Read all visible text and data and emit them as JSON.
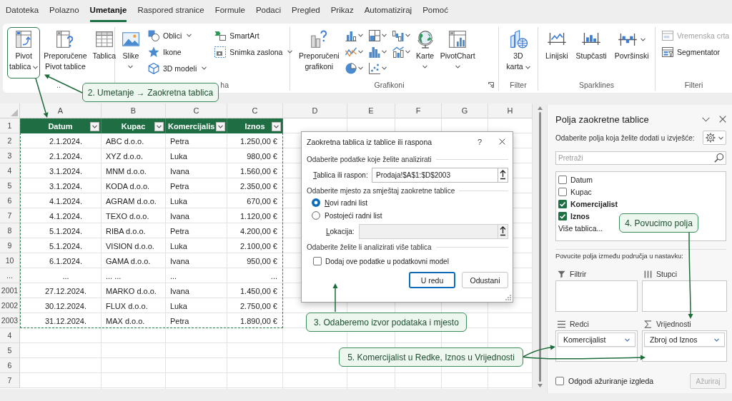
{
  "tabs": [
    {
      "label": "Datoteka",
      "selected": false
    },
    {
      "label": "Polazno",
      "selected": false
    },
    {
      "label": "Umetanje",
      "selected": true
    },
    {
      "label": "Raspored stranice",
      "selected": false
    },
    {
      "label": "Formule",
      "selected": false
    },
    {
      "label": "Podaci",
      "selected": false
    },
    {
      "label": "Pregled",
      "selected": false
    },
    {
      "label": "Prikaz",
      "selected": false
    },
    {
      "label": "Automatiziraj",
      "selected": false
    },
    {
      "label": "Pomoć",
      "selected": false
    }
  ],
  "ribbon": {
    "groups": [
      {
        "label": "..",
        "items": [
          {
            "kind": "large",
            "label": "Pivot\ntablica",
            "caret": true,
            "highlighted": true
          },
          {
            "kind": "large",
            "label": "Preporučene\nPivot tablice",
            "highlighted": false
          },
          {
            "kind": "large",
            "label": "Tablica",
            "highlighted": false
          }
        ]
      },
      {
        "label": "ha",
        "items": [
          {
            "kind": "large",
            "label": "Slike",
            "caret": true
          },
          {
            "kind": "stack",
            "items": [
              {
                "kind": "small",
                "label": "Oblici",
                "caret": true
              },
              {
                "kind": "small",
                "label": "Ikone"
              },
              {
                "kind": "small",
                "label": "3D modeli",
                "caret": true
              }
            ]
          },
          {
            "kind": "stack",
            "items": [
              {
                "kind": "small",
                "label": "SmartArt"
              },
              {
                "kind": "small",
                "label": "Snimka zaslona",
                "caret": true
              }
            ]
          }
        ]
      },
      {
        "label": "Grafikoni",
        "launcher": true,
        "items": [
          {
            "kind": "large",
            "label": "Preporučeni\ngrafikoni"
          },
          {
            "kind": "stack",
            "items": [
              {
                "kind": "icon",
                "caret": true
              },
              {
                "kind": "icon",
                "caret": true
              },
              {
                "kind": "icon",
                "caret": true
              }
            ]
          },
          {
            "kind": "stack",
            "items": [
              {
                "kind": "icon",
                "caret": true
              },
              {
                "kind": "icon",
                "caret": true
              },
              {
                "kind": "icon",
                "caret": true
              }
            ]
          },
          {
            "kind": "stack",
            "items": [
              {
                "kind": "icon",
                "caret": true
              },
              {
                "kind": "icon",
                "caret": true
              }
            ]
          },
          {
            "kind": "large",
            "label": "Karte",
            "caret": true
          },
          {
            "kind": "large",
            "label": "PivotChart",
            "caret": true
          }
        ]
      },
      {
        "label": "Filter",
        "items": [
          {
            "kind": "large",
            "label": "3D\nkarta",
            "caret": true
          }
        ]
      },
      {
        "label": "Sparklines",
        "items": [
          {
            "kind": "large",
            "label": "Linijski"
          },
          {
            "kind": "large",
            "label": "Stupčasti"
          },
          {
            "kind": "gallery",
            "label": "Površinski",
            "caret": true
          }
        ]
      },
      {
        "label": "Filteri",
        "items": [
          {
            "kind": "stack",
            "items": [
              {
                "kind": "small",
                "label": "Vremenska crta",
                "disabled": true
              },
              {
                "kind": "small",
                "label": "Segmentator",
                "disabled": false
              }
            ]
          }
        ]
      }
    ]
  },
  "sheet": {
    "column_headers": [
      "A",
      "B",
      "C",
      "C",
      "D",
      "E",
      "F",
      "G",
      "H"
    ],
    "row_headers": [
      "1",
      "2",
      "3",
      "4",
      "5",
      "6",
      "7",
      "8",
      "9",
      "10",
      "...",
      "2001",
      "2002",
      "2003",
      "4",
      "5",
      "6",
      "7"
    ],
    "table": {
      "marquee": true,
      "columns": [
        {
          "label": "Datum",
          "filter": true
        },
        {
          "label": "Kupac",
          "filter": true
        },
        {
          "label": "Komercijalis",
          "filter": true
        },
        {
          "label": "Iznos",
          "filter": true
        }
      ],
      "rows": [
        [
          "2.1.2024.",
          "ABC d.o.o.",
          "Petra",
          "1.250,00 €"
        ],
        [
          "2.1.2024.",
          "XYZ d.o.o.",
          "Luka",
          "980,00 €"
        ],
        [
          "3.1.2024.",
          "MNM d.o.o.",
          "Ivana",
          "1.560,00 €"
        ],
        [
          "3.1.2024.",
          "KODA d.o.o.",
          "Petra",
          "2.350,00 €"
        ],
        [
          "4.1.2024.",
          "AGRAM d.o.o.",
          "Luka",
          "670,00 €"
        ],
        [
          "4.1.2024.",
          "TEXO d.o.o.",
          "Ivana",
          "1.120,00 €"
        ],
        [
          "5.1.2024.",
          "RIBA d.o.o.",
          "Petra",
          "4.200,00 €"
        ],
        [
          "5.1.2024.",
          "VISION d.o.o.",
          "Luka",
          "2.100,00 €"
        ],
        [
          "6.1.2024.",
          "GAMA d.o.o.",
          "Ivana",
          "950,00 €"
        ],
        [
          "...",
          "... ...",
          "...",
          "..."
        ],
        [
          "27.12.2024.",
          "MARKO d.o.o.",
          "Ivana",
          "1.450,00 €"
        ],
        [
          "30.12.2024.",
          "FLUX d.o.o.",
          "Luka",
          "2.750,00 €"
        ],
        [
          "31.12.2024.",
          "MAX d.o.o.",
          "Petra",
          "1.890,00 €"
        ]
      ]
    }
  },
  "dialog": {
    "title": "Zaokretna tablica iz tablice ili raspona",
    "help": "?",
    "source": {
      "heading": "Odaberite podatke koje želite analizirati",
      "label": "Tablica ili raspon:",
      "value": "Prodaja!$A$1:$D$2003"
    },
    "destination": {
      "heading": "Odaberite mjesto za smještaj zaokretne tablice",
      "options": [
        {
          "label": "Novi radni list",
          "selected": true
        },
        {
          "label": "Postojeći radni list",
          "selected": false
        }
      ],
      "location": {
        "label": "Lokacija:",
        "disabled": true
      }
    },
    "model": {
      "heading": "Odaberite želite li analizirati više tablica",
      "label": "Dodaj ove podatke u podatkovni model",
      "checked": false
    },
    "buttons": [
      {
        "label": "U redu",
        "default": true
      },
      {
        "label": "Odustani",
        "default": false
      }
    ]
  },
  "pane": {
    "title": "Polja zaokretne tablice",
    "prompt": "Odaberite polja koja želite dodati u izvješće:",
    "search": {
      "placeholder": "Pretraži"
    },
    "fields": [
      {
        "label": "Datum",
        "checked": false
      },
      {
        "label": "Kupac",
        "checked": false
      },
      {
        "label": "Komercijalist",
        "checked": true
      },
      {
        "label": "Iznos",
        "checked": true
      }
    ],
    "more_link": "Više tablica...",
    "areas_hint": "Povucite polja između područja u nastavku:",
    "areas": [
      {
        "label": "Filtrir"
      },
      {
        "label": "Stupci"
      },
      {
        "label": "Redci",
        "fields": [
          "Komercijalist"
        ]
      },
      {
        "label": "Vrijednosti",
        "fields": [
          "Zbroj od Iznos"
        ]
      }
    ],
    "defer": {
      "label": "Odgodi ažuriranje izgleda",
      "checked": false
    },
    "update_button": {
      "label": "Ažuriraj",
      "disabled": true
    }
  },
  "callouts": [
    "2. Umetanje → Zaokretna tablica",
    "3. Odaberemo izvor podataka i mjesto",
    "4. Povucimo polja",
    "5. Komercijalist u Redke, Iznos u Vrijednosti"
  ]
}
